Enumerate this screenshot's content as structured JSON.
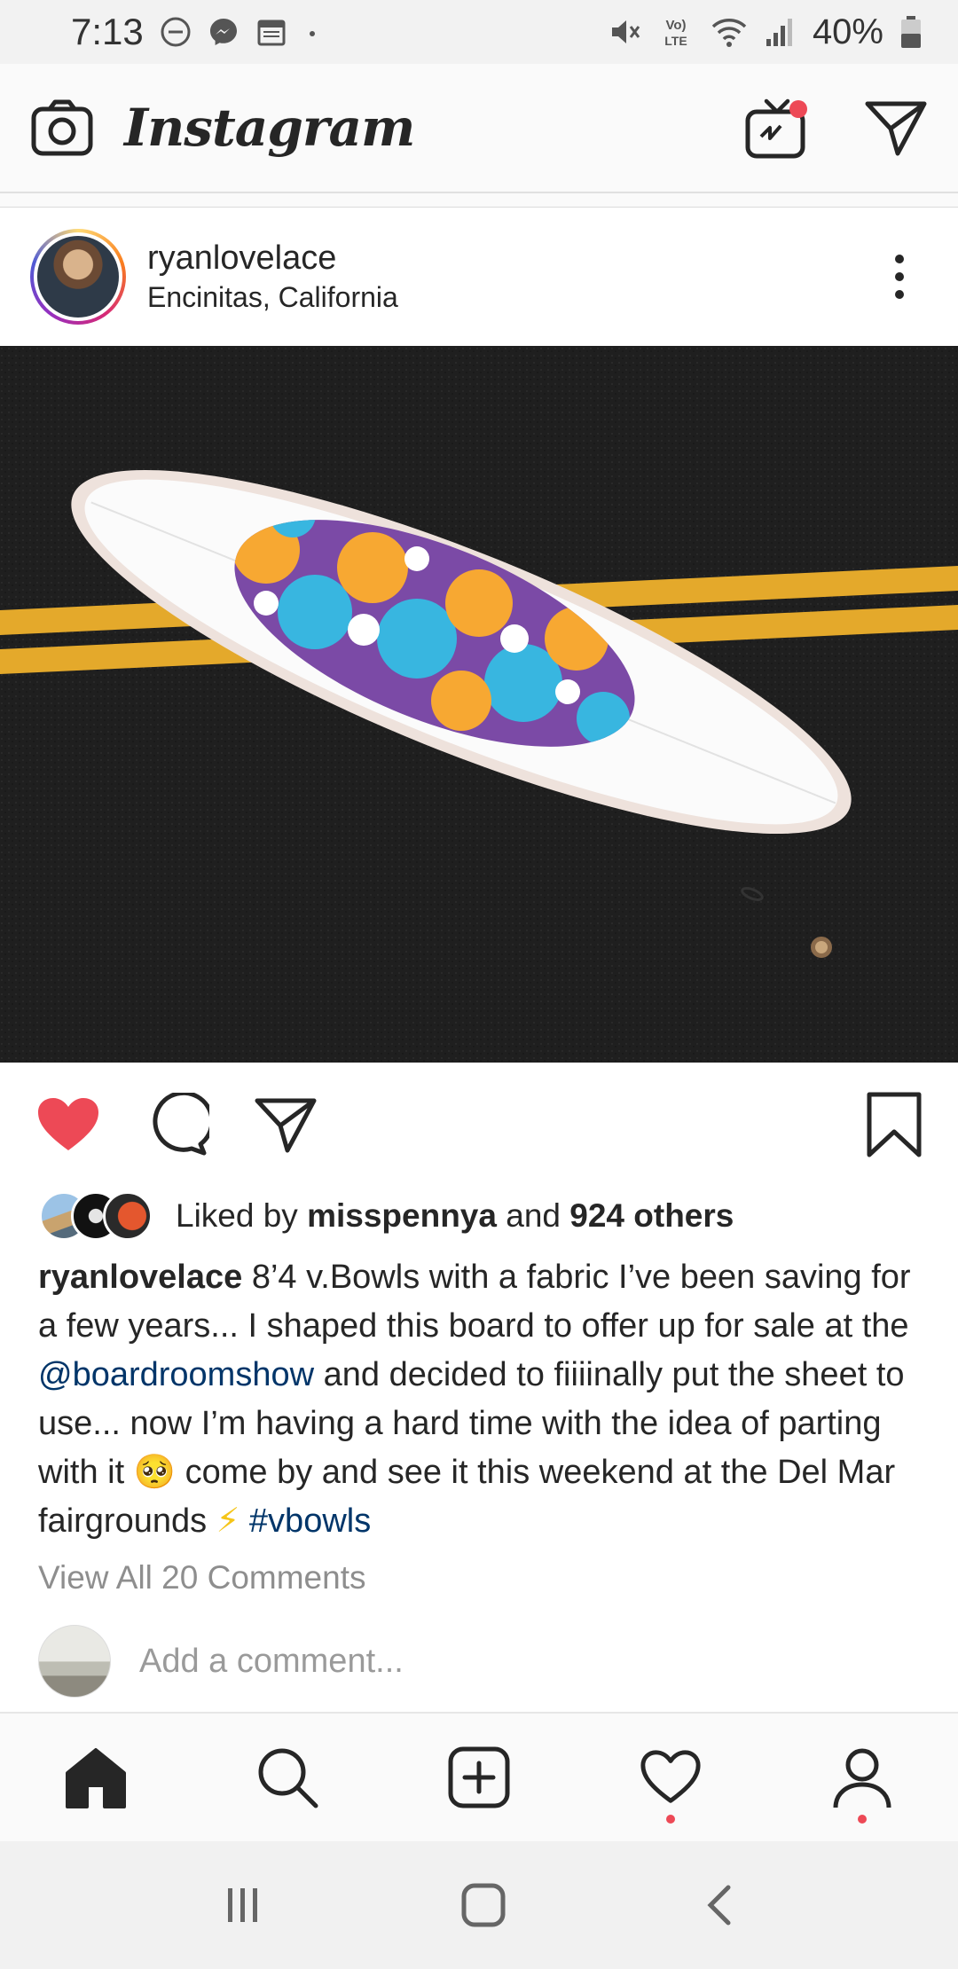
{
  "status_bar": {
    "time": "7:13",
    "battery": "40%",
    "network": "VoLTE",
    "icons": [
      "dnd-icon",
      "messenger-icon",
      "calendar-icon",
      "dot-icon",
      "mute-icon",
      "volte-icon",
      "wifi-icon",
      "signal-icon",
      "battery-icon"
    ]
  },
  "header": {
    "logo": "Instagram",
    "icons": [
      "camera-icon",
      "igtv-icon",
      "direct-icon"
    ],
    "igtv_badge_color": "#ed4956"
  },
  "post": {
    "username": "ryanlovelace",
    "location": "Encinitas, California",
    "image_description_icon": "surfboard-photo",
    "liked": true,
    "likes": {
      "prefix": "Liked by ",
      "first_liker": "misspennya",
      "joiner": " and ",
      "others": "924 others"
    },
    "caption": {
      "user": "ryanlovelace",
      "text_1": " 8’4 v.Bowls with a fabric I’ve been saving for a few years... I shaped this board to offer up for sale at the ",
      "mention": "@boardroomshow",
      "text_2": " and decided to fiiiinally put the sheet to use... now I’m having a hard time with the idea of parting with it ",
      "emoji_1": "🥺",
      "text_3": " come by and see it this weekend at the Del Mar fairgrounds ",
      "emoji_2": "⚡",
      "text_4": " ",
      "hashtag": "#vbowls"
    },
    "view_comments": "View All 20 Comments",
    "add_comment_placeholder": "Add a comment..."
  },
  "colors": {
    "heart": "#ed4956",
    "link": "#003569",
    "muted": "#8e8e8e"
  },
  "bottom_nav": [
    "home-icon",
    "search-icon",
    "new-post-icon",
    "activity-icon",
    "profile-icon"
  ],
  "system_nav": [
    "recents-icon",
    "home-button-icon",
    "back-icon"
  ]
}
